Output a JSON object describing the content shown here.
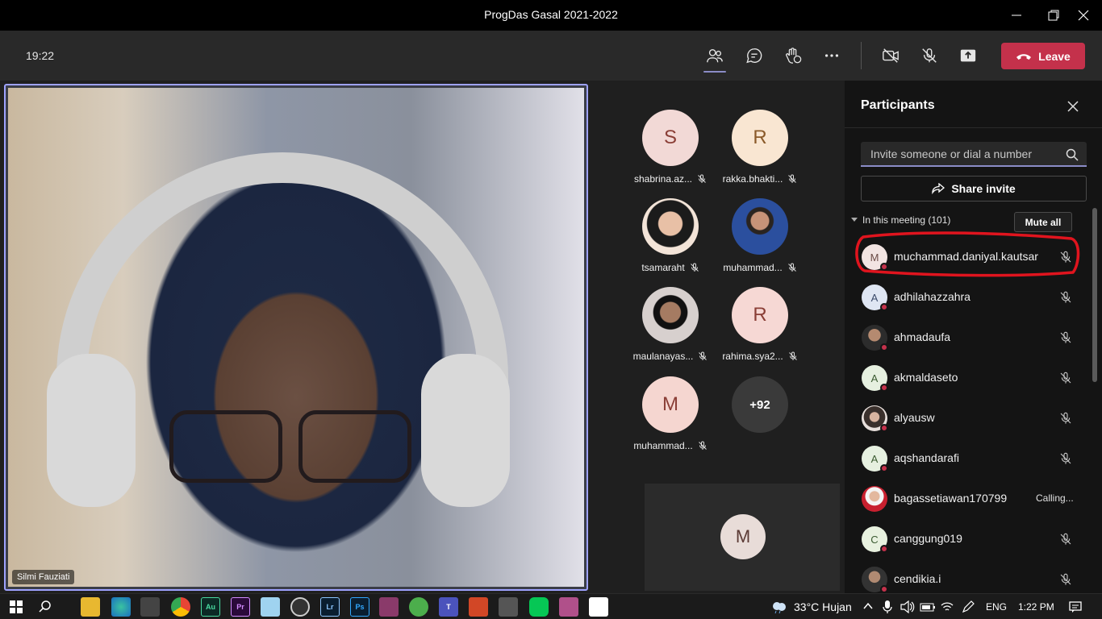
{
  "window": {
    "title": "ProgDas Gasal 2021-2022",
    "controls": [
      "minimize",
      "maximize",
      "close"
    ]
  },
  "header": {
    "time": "19:22",
    "buttons": [
      {
        "name": "participants",
        "icon": "people-icon",
        "active": true
      },
      {
        "name": "chat",
        "icon": "chat-icon"
      },
      {
        "name": "reactions",
        "icon": "raise-hand-icon"
      },
      {
        "name": "more",
        "icon": "more-icon"
      },
      {
        "name": "camera",
        "icon": "camera-off-icon"
      },
      {
        "name": "mic",
        "icon": "mic-off-icon"
      },
      {
        "name": "share",
        "icon": "share-tray-icon"
      }
    ],
    "leave_label": "Leave",
    "leave_color": "#c4314b"
  },
  "main_video": {
    "name": "Silmi Fauziati",
    "border_color": "#9ea2ff"
  },
  "gallery": {
    "tiles": [
      {
        "initial": "S",
        "label": "shabrina.az...",
        "bg": "#f2d9d6",
        "fg": "#8a3e36"
      },
      {
        "initial": "R",
        "label": "rakka.bhakti...",
        "bg": "#f9e6d2",
        "fg": "#8a5a2a"
      },
      {
        "initial": "",
        "label": "tsamaraht",
        "photo": true
      },
      {
        "initial": "",
        "label": "muhammad...",
        "photo": true
      },
      {
        "initial": "",
        "label": "maulanayas...",
        "photo": true
      },
      {
        "initial": "R",
        "label": "rahima.sya2...",
        "bg": "#f6d8d4",
        "fg": "#8a3e36"
      },
      {
        "initial": "M",
        "label": "muhammad...",
        "bg": "#f5d6d0",
        "fg": "#8a3e36"
      },
      {
        "initial": "+92",
        "label": "",
        "bg": "#3a3a3a",
        "fg": "#ffffff"
      }
    ],
    "bottom_tile_initial": "M"
  },
  "panel": {
    "title": "Participants",
    "invite_placeholder": "Invite someone or dial a number",
    "share_label": "Share invite",
    "section_label": "In this meeting (101)",
    "mute_all_label": "Mute all",
    "participants": [
      {
        "initial": "M",
        "name": "muchammad.daniyal.kautsar",
        "status": "",
        "bg": "#f2e4e2"
      },
      {
        "initial": "A",
        "name": "adhilahazzahra",
        "status": "",
        "bg": "#dfe6f3"
      },
      {
        "initial": "",
        "name": "ahmadaufa",
        "status": "",
        "bg": "#5b5b5b",
        "photo": true
      },
      {
        "initial": "A",
        "name": "akmaldaseto",
        "status": "",
        "bg": "#e6f0e0"
      },
      {
        "initial": "",
        "name": "alyausw",
        "status": "",
        "bg": "#7d6a60",
        "photo": true
      },
      {
        "initial": "A",
        "name": "aqshandarafi",
        "status": "",
        "bg": "#e6f0e0"
      },
      {
        "initial": "",
        "name": "bagassetiawan170799",
        "status": "Calling...",
        "bg": "#c8202f",
        "photo": true
      },
      {
        "initial": "C",
        "name": "canggung019",
        "status": "",
        "bg": "#e8f1df"
      },
      {
        "initial": "",
        "name": "cendikia.i",
        "status": "",
        "bg": "#4c4c4c",
        "photo": true
      }
    ]
  },
  "taskbar": {
    "apps": [
      "windows-icon",
      "search-icon",
      "file-explorer-icon",
      "edge-icon",
      "store-icon",
      "chrome-icon",
      "audition-icon",
      "premiere-icon",
      "notepad-icon",
      "obs-icon",
      "lightroom-icon",
      "photoshop-icon",
      "winrar-icon",
      "utorrent-icon",
      "teams-icon",
      "powerpoint-icon",
      "audio-icon",
      "line-icon",
      "winrar2-icon",
      "paint-icon"
    ],
    "weather": "33°C  Hujan",
    "language": "ENG",
    "clock": "1:22 PM"
  }
}
